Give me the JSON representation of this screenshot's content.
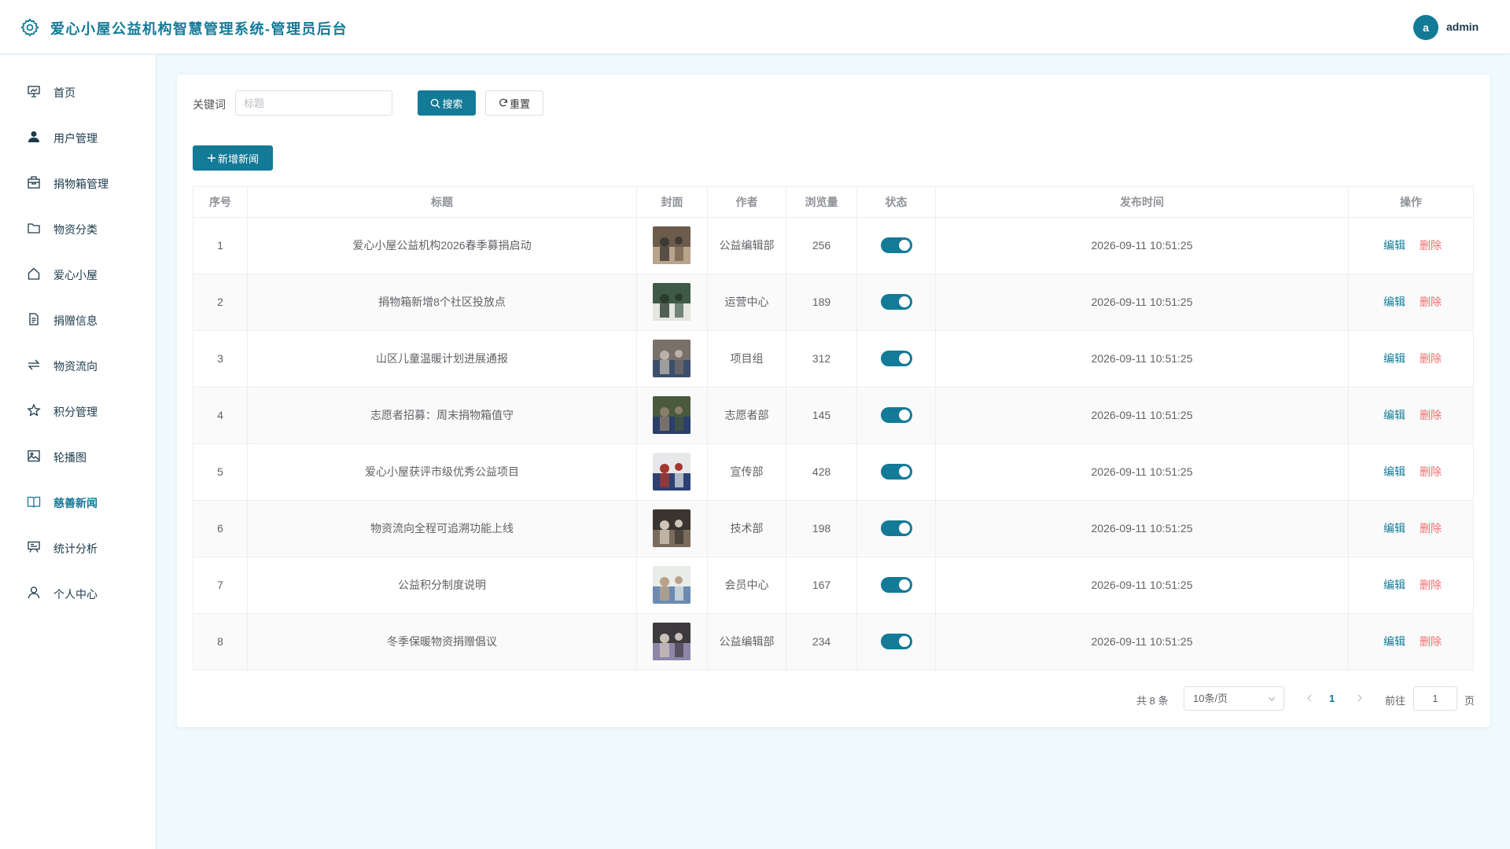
{
  "header": {
    "title": "爱心小屋公益机构智慧管理系统-管理员后台",
    "avatar_letter": "a",
    "username": "admin"
  },
  "sidebar": {
    "items": [
      {
        "label": "首页",
        "icon": "dashboard-icon"
      },
      {
        "label": "用户管理",
        "icon": "user-filled-icon"
      },
      {
        "label": "捐物箱管理",
        "icon": "box-icon"
      },
      {
        "label": "物资分类",
        "icon": "folder-icon"
      },
      {
        "label": "爱心小屋",
        "icon": "house-icon"
      },
      {
        "label": "捐赠信息",
        "icon": "document-icon"
      },
      {
        "label": "物资流向",
        "icon": "switch-icon"
      },
      {
        "label": "积分管理",
        "icon": "star-icon"
      },
      {
        "label": "轮播图",
        "icon": "picture-icon"
      },
      {
        "label": "慈善新闻",
        "icon": "reading-icon"
      },
      {
        "label": "统计分析",
        "icon": "data-board-icon"
      },
      {
        "label": "个人中心",
        "icon": "user-icon"
      }
    ],
    "active_index": 9
  },
  "search": {
    "label": "关键词",
    "placeholder": "标题",
    "value": "",
    "search_label": "搜索",
    "reset_label": "重置"
  },
  "toolbar": {
    "add_label": "新增新闻"
  },
  "table": {
    "columns": [
      "序号",
      "标题",
      "封面",
      "作者",
      "浏览量",
      "状态",
      "发布时间",
      "操作"
    ],
    "edit_label": "编辑",
    "delete_label": "删除",
    "rows": [
      {
        "index": "1",
        "title": "爱心小屋公益机构2026春季募捐启动",
        "author": "公益编辑部",
        "views": "256",
        "status": true,
        "time": "2026-09-11 10:51:25"
      },
      {
        "index": "2",
        "title": "捐物箱新增8个社区投放点",
        "author": "运营中心",
        "views": "189",
        "status": true,
        "time": "2026-09-11 10:51:25"
      },
      {
        "index": "3",
        "title": "山区儿童温暖计划进展通报",
        "author": "项目组",
        "views": "312",
        "status": true,
        "time": "2026-09-11 10:51:25"
      },
      {
        "index": "4",
        "title": "志愿者招募：周末捐物箱值守",
        "author": "志愿者部",
        "views": "145",
        "status": true,
        "time": "2026-09-11 10:51:25"
      },
      {
        "index": "5",
        "title": "爱心小屋获评市级优秀公益项目",
        "author": "宣传部",
        "views": "428",
        "status": true,
        "time": "2026-09-11 10:51:25"
      },
      {
        "index": "6",
        "title": "物资流向全程可追溯功能上线",
        "author": "技术部",
        "views": "198",
        "status": true,
        "time": "2026-09-11 10:51:25"
      },
      {
        "index": "7",
        "title": "公益积分制度说明",
        "author": "会员中心",
        "views": "167",
        "status": true,
        "time": "2026-09-11 10:51:25"
      },
      {
        "index": "8",
        "title": "冬季保暖物资捐赠倡议",
        "author": "公益编辑部",
        "views": "234",
        "status": true,
        "time": "2026-09-11 10:51:25"
      }
    ]
  },
  "pagination": {
    "total_text": "共 8 条",
    "page_size": "10条/页",
    "current_page": "1",
    "goto_label": "前往",
    "goto_value": "1",
    "page_suffix": "页"
  },
  "colors": {
    "primary": "#137a97",
    "danger": "#f56c6c",
    "background": "#eefafd"
  }
}
